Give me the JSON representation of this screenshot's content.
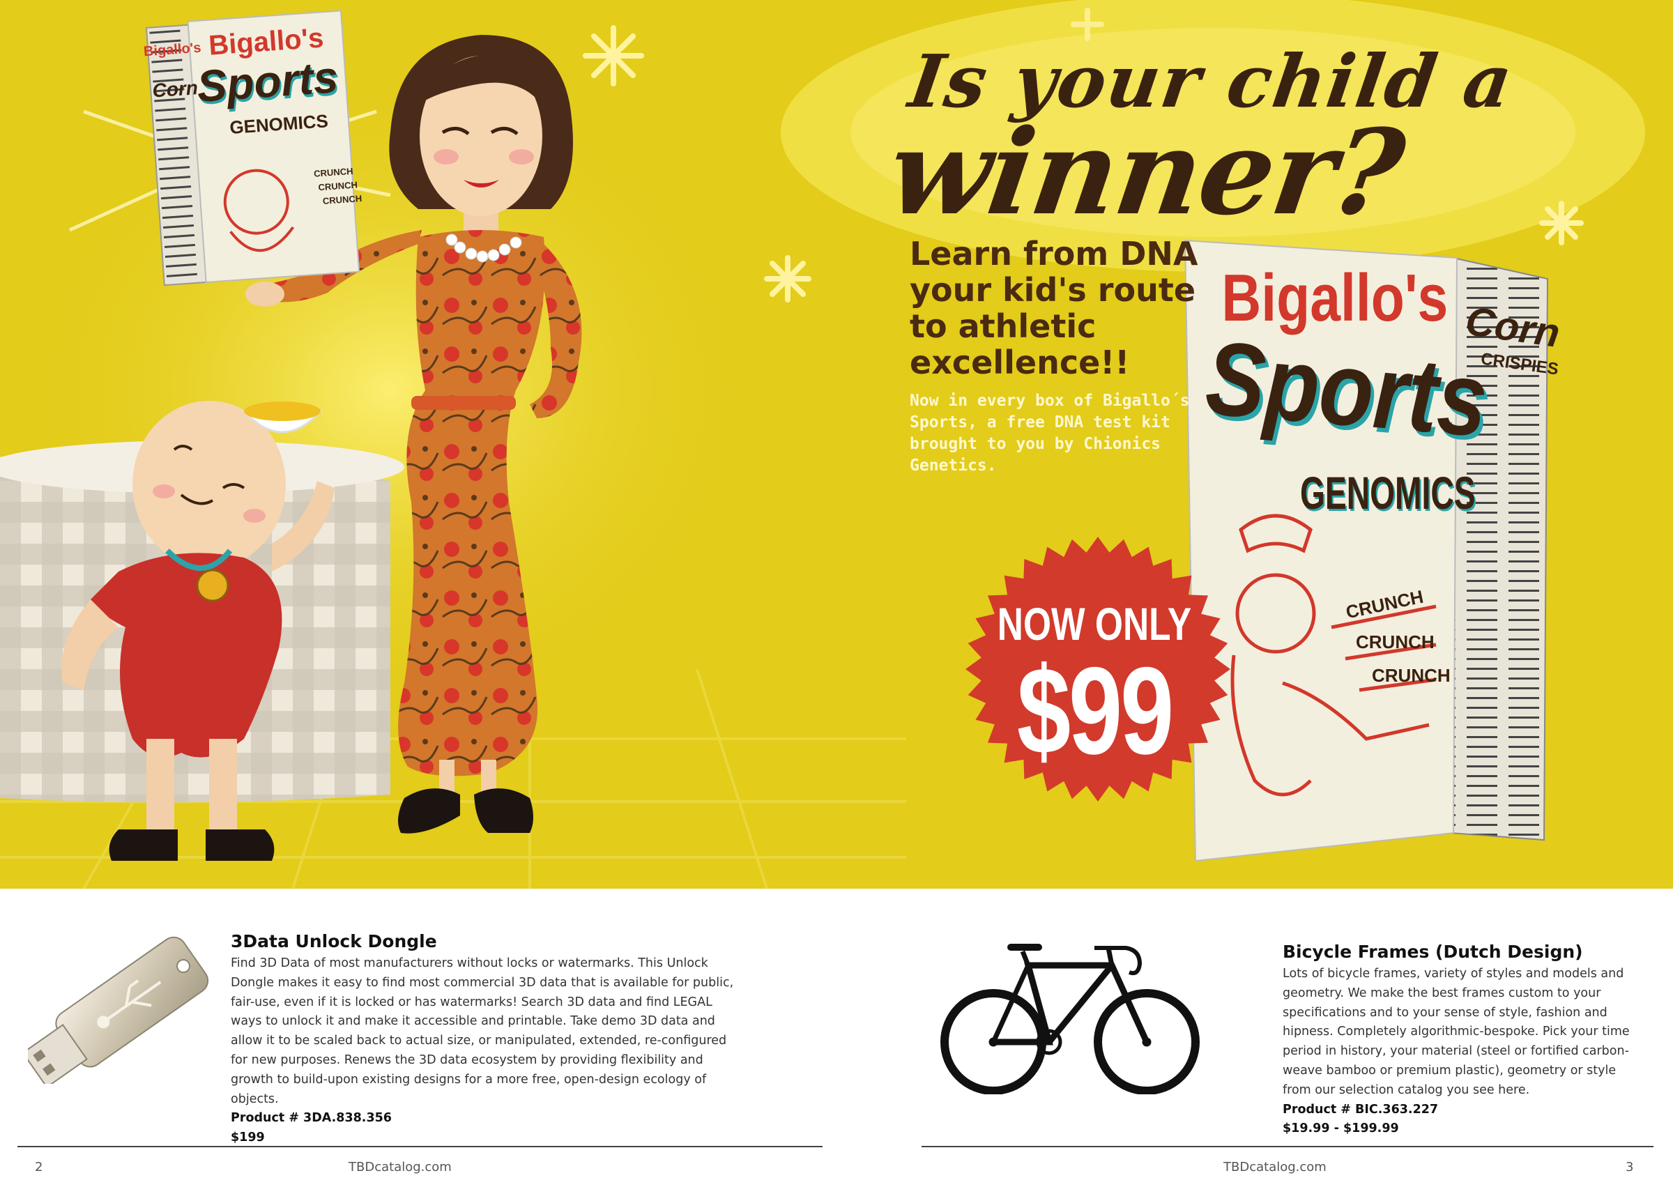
{
  "ad": {
    "headline_line1": "Is your child a",
    "headline_line2": "winner?",
    "tagline": "Learn from DNA your kid's route to athletic excellence!!",
    "subtag": "Now in every box of Bigallo´s Sports, a free DNA test kit brought to you by Chionics Genetics.",
    "badge_top": "NOW ONLY",
    "badge_price": "$99",
    "box": {
      "brand": "Bigallo's",
      "name": "Sports",
      "sub": "GENOMICS",
      "side_top": "Corn",
      "side_sub": "CRISPIES",
      "crunch": [
        "CRUNCH",
        "CRUNCH",
        "CRUNCH"
      ]
    },
    "colors": {
      "background": "#e3cc1a",
      "headline": "#3a2210",
      "badge": "#d23a2c",
      "box_red": "#d2382b",
      "box_teal": "#2aa4a8"
    }
  },
  "products": [
    {
      "title": "3Data Unlock Dongle",
      "description": "Find 3D Data of most manufacturers without locks or watermarks. This Unlock Dongle makes it easy to find most commercial 3D data that is available for public, fair-use, even if it is locked or has watermarks! Search 3D data and find LEGAL ways to unlock it and make it accessible and printable. Take demo 3D data and allow it to be scaled back to actual size, or manipulated, extended, re-configured for new purposes. Renews the 3D data ecosystem by providing flexibility and growth to build-upon existing designs for a more free, open-design ecology of objects.",
      "product_number": "Product # 3DA.838.356",
      "price": "$199"
    },
    {
      "title": "Bicycle Frames (Dutch Design)",
      "description": "Lots of bicycle frames, variety of styles and models and geometry. We make the best frames custom to your specifications and to your sense of style, fashion and hipness. Completely algorithmic-bespoke. Pick your time period in history, your material (steel or fortified carbon-weave bamboo or premium plastic), geometry or style from our selection catalog you see here.",
      "product_number": "Product # BIC.363.227",
      "price": "$19.99 - $199.99"
    }
  ],
  "footer": {
    "left_page": "2",
    "left_site": "TBDcatalog.com",
    "right_site": "TBDcatalog.com",
    "right_page": "3"
  }
}
